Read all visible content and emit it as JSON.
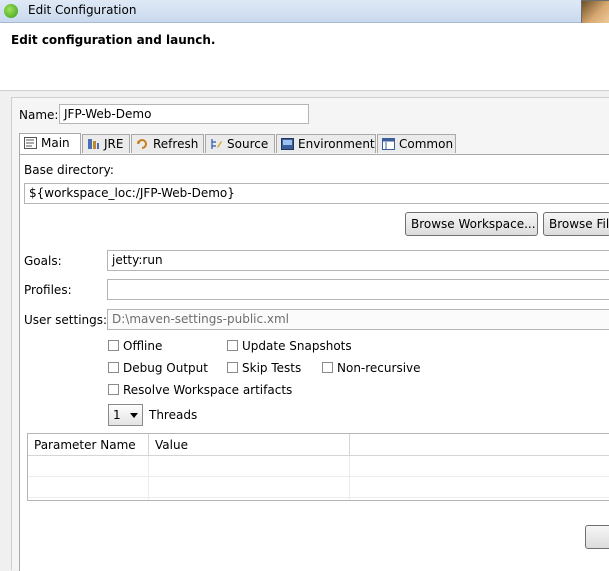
{
  "window": {
    "title": "Edit Configuration"
  },
  "header": {
    "title": "Edit configuration and launch."
  },
  "name": {
    "label": "Name:",
    "value": "JFP-Web-Demo"
  },
  "tabs": [
    {
      "label": "Main",
      "icon": "main-tab-icon",
      "active": true
    },
    {
      "label": "JRE",
      "icon": "jre-icon"
    },
    {
      "label": "Refresh",
      "icon": "refresh-icon"
    },
    {
      "label": "Source",
      "icon": "source-icon"
    },
    {
      "label": "Environment",
      "icon": "environment-icon"
    },
    {
      "label": "Common",
      "icon": "common-icon"
    }
  ],
  "main": {
    "base_dir_label": "Base directory:",
    "base_dir_value": "${workspace_loc:/JFP-Web-Demo}",
    "browse_workspace": "Browse Workspace...",
    "browse_file": "Browse File",
    "goals_label": "Goals:",
    "goals_value": "jetty:run",
    "profiles_label": "Profiles:",
    "profiles_value": "",
    "user_settings_label": "User settings:",
    "user_settings_value": "D:\\maven-settings-public.xml",
    "offline": "Offline",
    "update_snapshots": "Update Snapshots",
    "debug_output": "Debug Output",
    "skip_tests": "Skip Tests",
    "non_recursive": "Non-recursive",
    "resolve_workspace": "Resolve Workspace artifacts",
    "threads_value": "1",
    "threads_label": "Threads",
    "table_headers": [
      "Parameter Name",
      "Value"
    ]
  },
  "colors": {
    "title_bar": "#c9d9ee",
    "panel": "#ffffff",
    "accent_icon": "#3a9a1a"
  }
}
